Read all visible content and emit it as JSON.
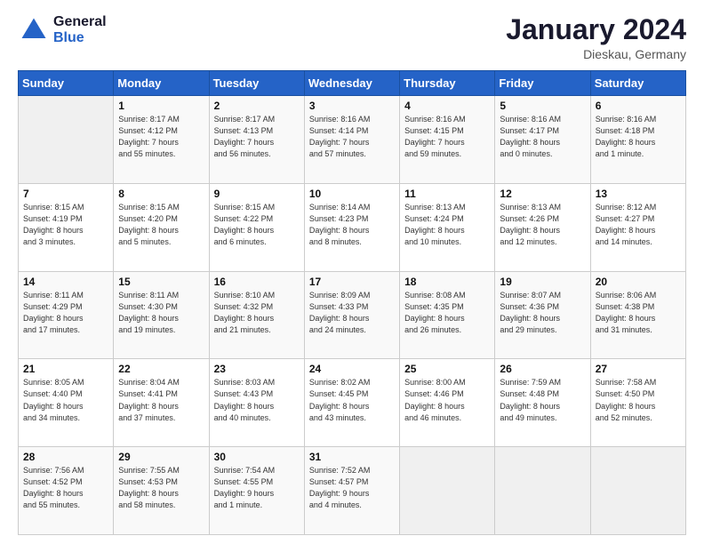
{
  "logo": {
    "line1": "General",
    "line2": "Blue"
  },
  "title": {
    "month_year": "January 2024",
    "location": "Dieskau, Germany"
  },
  "days_of_week": [
    "Sunday",
    "Monday",
    "Tuesday",
    "Wednesday",
    "Thursday",
    "Friday",
    "Saturday"
  ],
  "weeks": [
    [
      {
        "day": "",
        "info": ""
      },
      {
        "day": "1",
        "info": "Sunrise: 8:17 AM\nSunset: 4:12 PM\nDaylight: 7 hours\nand 55 minutes."
      },
      {
        "day": "2",
        "info": "Sunrise: 8:17 AM\nSunset: 4:13 PM\nDaylight: 7 hours\nand 56 minutes."
      },
      {
        "day": "3",
        "info": "Sunrise: 8:16 AM\nSunset: 4:14 PM\nDaylight: 7 hours\nand 57 minutes."
      },
      {
        "day": "4",
        "info": "Sunrise: 8:16 AM\nSunset: 4:15 PM\nDaylight: 7 hours\nand 59 minutes."
      },
      {
        "day": "5",
        "info": "Sunrise: 8:16 AM\nSunset: 4:17 PM\nDaylight: 8 hours\nand 0 minutes."
      },
      {
        "day": "6",
        "info": "Sunrise: 8:16 AM\nSunset: 4:18 PM\nDaylight: 8 hours\nand 1 minute."
      }
    ],
    [
      {
        "day": "7",
        "info": "Sunrise: 8:15 AM\nSunset: 4:19 PM\nDaylight: 8 hours\nand 3 minutes."
      },
      {
        "day": "8",
        "info": "Sunrise: 8:15 AM\nSunset: 4:20 PM\nDaylight: 8 hours\nand 5 minutes."
      },
      {
        "day": "9",
        "info": "Sunrise: 8:15 AM\nSunset: 4:22 PM\nDaylight: 8 hours\nand 6 minutes."
      },
      {
        "day": "10",
        "info": "Sunrise: 8:14 AM\nSunset: 4:23 PM\nDaylight: 8 hours\nand 8 minutes."
      },
      {
        "day": "11",
        "info": "Sunrise: 8:13 AM\nSunset: 4:24 PM\nDaylight: 8 hours\nand 10 minutes."
      },
      {
        "day": "12",
        "info": "Sunrise: 8:13 AM\nSunset: 4:26 PM\nDaylight: 8 hours\nand 12 minutes."
      },
      {
        "day": "13",
        "info": "Sunrise: 8:12 AM\nSunset: 4:27 PM\nDaylight: 8 hours\nand 14 minutes."
      }
    ],
    [
      {
        "day": "14",
        "info": "Sunrise: 8:11 AM\nSunset: 4:29 PM\nDaylight: 8 hours\nand 17 minutes."
      },
      {
        "day": "15",
        "info": "Sunrise: 8:11 AM\nSunset: 4:30 PM\nDaylight: 8 hours\nand 19 minutes."
      },
      {
        "day": "16",
        "info": "Sunrise: 8:10 AM\nSunset: 4:32 PM\nDaylight: 8 hours\nand 21 minutes."
      },
      {
        "day": "17",
        "info": "Sunrise: 8:09 AM\nSunset: 4:33 PM\nDaylight: 8 hours\nand 24 minutes."
      },
      {
        "day": "18",
        "info": "Sunrise: 8:08 AM\nSunset: 4:35 PM\nDaylight: 8 hours\nand 26 minutes."
      },
      {
        "day": "19",
        "info": "Sunrise: 8:07 AM\nSunset: 4:36 PM\nDaylight: 8 hours\nand 29 minutes."
      },
      {
        "day": "20",
        "info": "Sunrise: 8:06 AM\nSunset: 4:38 PM\nDaylight: 8 hours\nand 31 minutes."
      }
    ],
    [
      {
        "day": "21",
        "info": "Sunrise: 8:05 AM\nSunset: 4:40 PM\nDaylight: 8 hours\nand 34 minutes."
      },
      {
        "day": "22",
        "info": "Sunrise: 8:04 AM\nSunset: 4:41 PM\nDaylight: 8 hours\nand 37 minutes."
      },
      {
        "day": "23",
        "info": "Sunrise: 8:03 AM\nSunset: 4:43 PM\nDaylight: 8 hours\nand 40 minutes."
      },
      {
        "day": "24",
        "info": "Sunrise: 8:02 AM\nSunset: 4:45 PM\nDaylight: 8 hours\nand 43 minutes."
      },
      {
        "day": "25",
        "info": "Sunrise: 8:00 AM\nSunset: 4:46 PM\nDaylight: 8 hours\nand 46 minutes."
      },
      {
        "day": "26",
        "info": "Sunrise: 7:59 AM\nSunset: 4:48 PM\nDaylight: 8 hours\nand 49 minutes."
      },
      {
        "day": "27",
        "info": "Sunrise: 7:58 AM\nSunset: 4:50 PM\nDaylight: 8 hours\nand 52 minutes."
      }
    ],
    [
      {
        "day": "28",
        "info": "Sunrise: 7:56 AM\nSunset: 4:52 PM\nDaylight: 8 hours\nand 55 minutes."
      },
      {
        "day": "29",
        "info": "Sunrise: 7:55 AM\nSunset: 4:53 PM\nDaylight: 8 hours\nand 58 minutes."
      },
      {
        "day": "30",
        "info": "Sunrise: 7:54 AM\nSunset: 4:55 PM\nDaylight: 9 hours\nand 1 minute."
      },
      {
        "day": "31",
        "info": "Sunrise: 7:52 AM\nSunset: 4:57 PM\nDaylight: 9 hours\nand 4 minutes."
      },
      {
        "day": "",
        "info": ""
      },
      {
        "day": "",
        "info": ""
      },
      {
        "day": "",
        "info": ""
      }
    ]
  ]
}
